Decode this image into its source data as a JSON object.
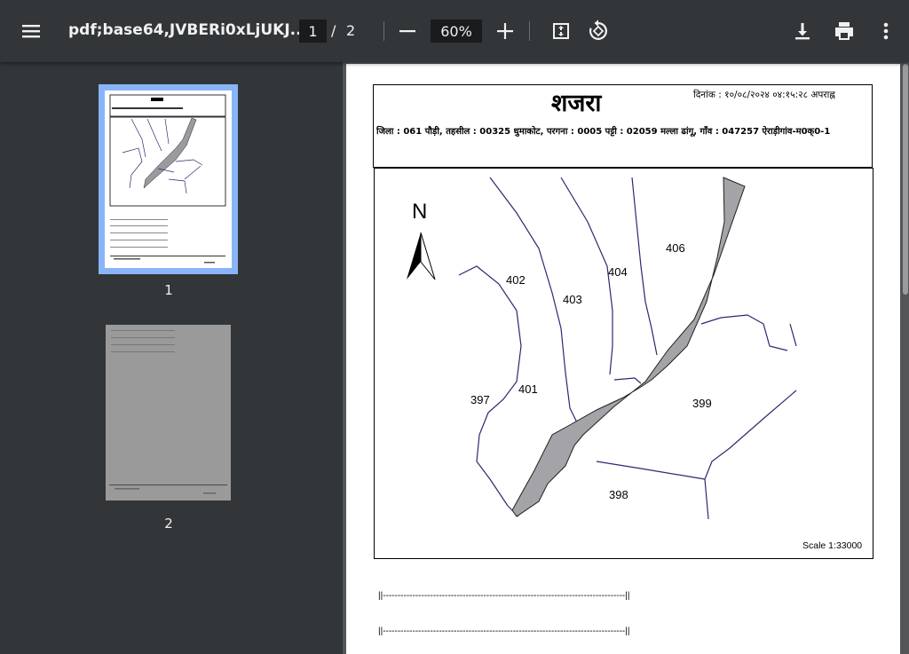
{
  "toolbar": {
    "file_title": "pdf;base64,JVBERi0xLjUKJ...",
    "current_page": "1",
    "page_separator": "/",
    "total_pages": "2",
    "zoom_level": "60%"
  },
  "sidebar": {
    "thumbnails": [
      {
        "label": "1",
        "selected": true
      },
      {
        "label": "2",
        "selected": false
      }
    ]
  },
  "document": {
    "title": "शजरा",
    "date_line": "दिनांक : १०/०८/२०२४ ०४:१५:२८ अपराह्न",
    "location_line": "जिला : 061 पौड़ी, तहसील : 00325 धुमाकोट, परगना : 0005 पट्टी : 02059 मल्ला ढांगू, गाँव : 047257 ऐराड़ीगांव-म0क्0-1",
    "north_label": "N",
    "plots": [
      "402",
      "403",
      "404",
      "406",
      "401",
      "397",
      "399",
      "398"
    ],
    "scale_text": "Scale 1:33000",
    "rule_lines": [
      "||----------------------------------------------------------------------------------||",
      "||----------------------------------------------------------------------------------||"
    ]
  },
  "colors": {
    "toolbar_bg": "#323639",
    "viewer_bg": "#525659",
    "thumb_selected_border": "#8ab4f8",
    "road_fill": "#a3a3a8",
    "boundary_line": "#2a2a70"
  }
}
